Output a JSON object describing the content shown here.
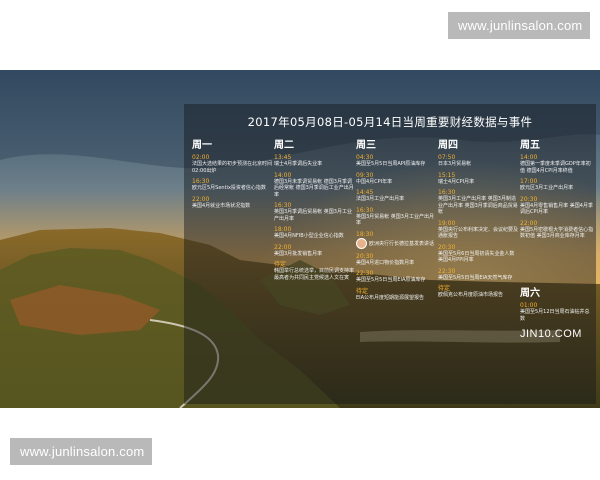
{
  "watermark_top": "www.junlinsalon.com",
  "watermark_bottom": "www.junlinsalon.com",
  "panel": {
    "title": "2017年05月08日-05月14日当周重要财经数据与事件",
    "brand": "JIN10.COM"
  },
  "days": [
    {
      "label": "周一",
      "events": [
        {
          "time": "02:00",
          "desc": "法国大选结果的初步预测在北京时间02:00出炉"
        },
        {
          "time": "16:30",
          "desc": "欧元区5月Sentix投资者信心指数"
        },
        {
          "time": "22:00",
          "desc": "美国4月就业市场状况指数"
        }
      ]
    },
    {
      "label": "周二",
      "events": [
        {
          "time": "13:45",
          "desc": "瑞士4月季调后失业率"
        },
        {
          "time": "14:00",
          "desc": "德国3月未季调贸易帐 德国3月季调后经常帐 德国3月季调后工业产出月率"
        },
        {
          "time": "16:30",
          "desc": "英国3月季调后贸易帐 英国3月工业产出月率"
        },
        {
          "time": "18:00",
          "desc": "美国4月NFIB小型企业信心指数"
        },
        {
          "time": "22:00",
          "desc": "美国3月批发销售月率"
        },
        {
          "time": "待定",
          "desc": "韩国举行总统选举，目前民调支持率最高者为共同民主党候选人文在寅"
        }
      ]
    },
    {
      "label": "周三",
      "events": [
        {
          "time": "04:30",
          "desc": "美国至5月5日当周API原油库存"
        },
        {
          "time": "09:30",
          "desc": "中国4月CPI年率"
        },
        {
          "time": "14:45",
          "desc": "法国3月工业产出月率"
        },
        {
          "time": "16:30",
          "desc": "英国3月贸易帐 英国3月工业产出月率"
        },
        {
          "time": "18:30",
          "desc": "欧洲央行行长德拉基发表讲话"
        },
        {
          "time": "20:30",
          "desc": "美国4月进口物价指数月率"
        },
        {
          "time": "22:30",
          "desc": "美国至5月5日当周EIA原油库存"
        },
        {
          "time": "待定",
          "desc": "EIA公布月度短期能源展望报告"
        }
      ]
    },
    {
      "label": "周四",
      "events": [
        {
          "time": "07:50",
          "desc": "日本3月贸易帐"
        },
        {
          "time": "15:15",
          "desc": "瑞士4月CPI月率"
        },
        {
          "time": "16:30",
          "desc": "英国3月工业产出月率 英国3月制造业产出月率 英国3月季调后商品贸易帐"
        },
        {
          "time": "19:00",
          "desc": "英国央行公布利率决定、会议纪要及通胀报告"
        },
        {
          "time": "20:30",
          "desc": "美国至5月6日当周初请失业金人数 美国4月PPI月率"
        },
        {
          "time": "22:30",
          "desc": "美国至5月5日当周EIA天然气库存"
        },
        {
          "time": "待定",
          "desc": "欧佩克公布月度原油市场报告"
        }
      ]
    },
    {
      "label": "周五",
      "events": [
        {
          "time": "14:00",
          "desc": "德国第一季度未季调GDP年率初值 德国4月CPI月率终值"
        },
        {
          "time": "17:00",
          "desc": "欧元区3月工业产出月率"
        },
        {
          "time": "20:30",
          "desc": "美国4月零售销售月率 美国4月季调后CPI月率"
        },
        {
          "time": "22:00",
          "desc": "美国5月密歇根大学消费者信心指数初值 美国3月商业库存月率"
        }
      ]
    }
  ],
  "saturday": {
    "label": "周六",
    "events": [
      {
        "time": "01:00",
        "desc": "美国至5月12日当周石油钻井总数"
      }
    ]
  }
}
